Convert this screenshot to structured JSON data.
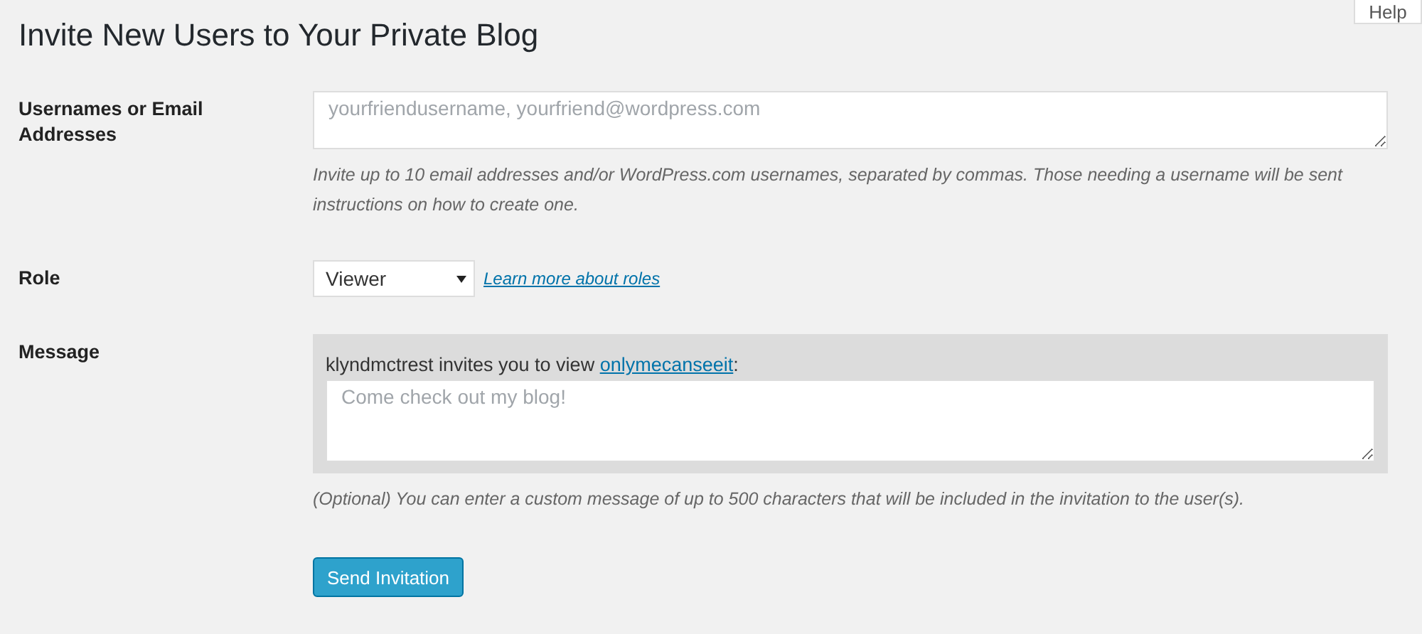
{
  "help_tab": {
    "label": "Help"
  },
  "title": "Invite New Users to Your Private Blog",
  "fields": [
    {
      "kind": "textarea",
      "label": "Usernames or Email Addresses",
      "placeholder": "yourfriendusername, yourfriend@wordpress.com",
      "description": "Invite up to 10 email addresses and/or WordPress.com usernames, separated by commas. Those needing a username will be sent instructions on how to create one."
    },
    {
      "kind": "select",
      "label": "Role",
      "value": "Viewer",
      "link": "Learn more about roles"
    },
    {
      "kind": "message",
      "label": "Message",
      "intro": "klyndmctrest invites you to view ",
      "blog_link": "onlymecanseeit",
      "intro_end": ":",
      "placeholder": "Come check out my blog!",
      "description": "(Optional) You can enter a custom message of up to 500 characters that will be included in the invitation to the user(s)."
    }
  ],
  "submit": "Send Invitation"
}
